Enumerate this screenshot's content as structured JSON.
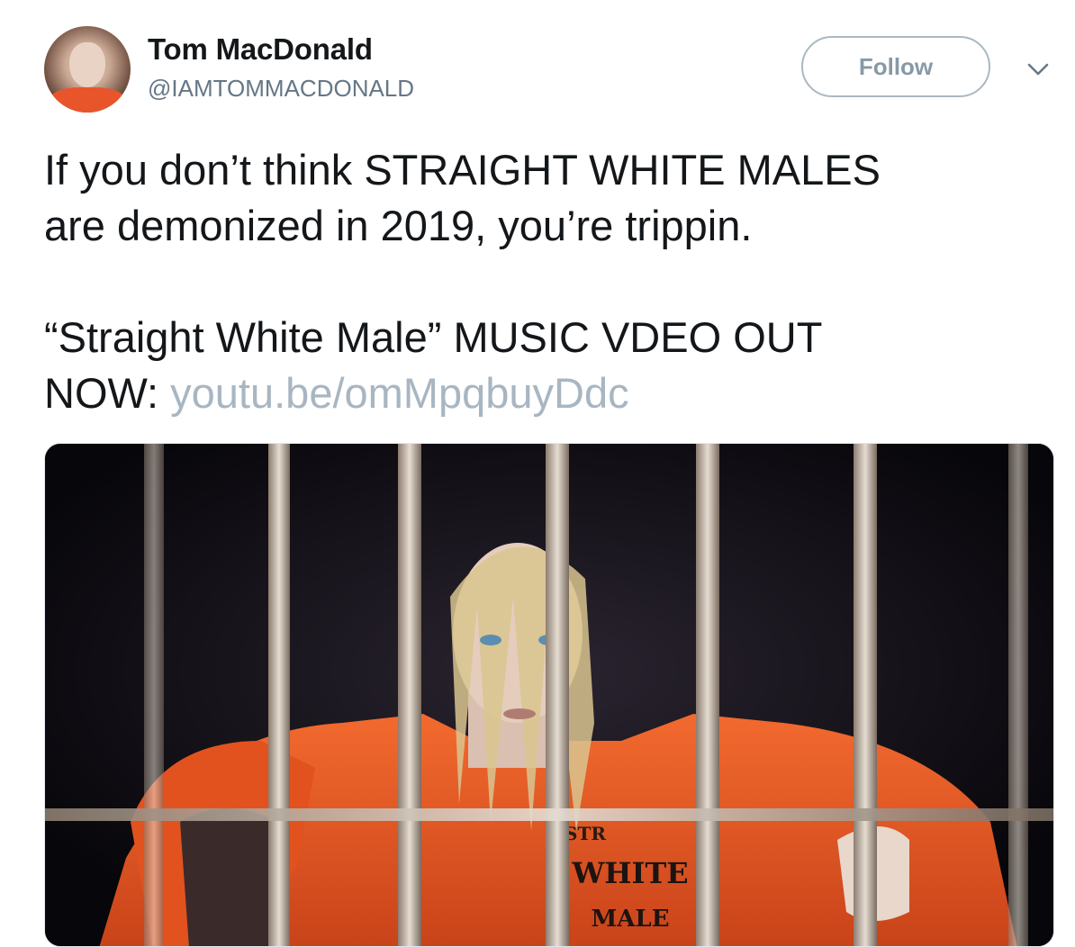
{
  "user": {
    "name": "Tom MacDonald",
    "handle": "@IAMTOMMACDONALD"
  },
  "actions": {
    "follow_label": "Follow"
  },
  "icons": {
    "more": "chevron-down-icon"
  },
  "tweet": {
    "line1": "If you don’t think STRAIGHT WHITE MALES",
    "line2": "are demonized in 2019, you’re trippin.",
    "line3": "“Straight White Male” MUSIC VDEO OUT",
    "line4_prefix": "NOW: ",
    "link": "youtu.be/omMpqbuyDdc"
  },
  "media": {
    "shirt_text_1": "STR",
    "shirt_text_2": "WHITE",
    "shirt_text_3": "MALE"
  },
  "colors": {
    "text": "#14171a",
    "muted": "#657786",
    "link": "#a8b6c2",
    "border": "#aab8c2",
    "jumpsuit": "#ec5a26"
  }
}
